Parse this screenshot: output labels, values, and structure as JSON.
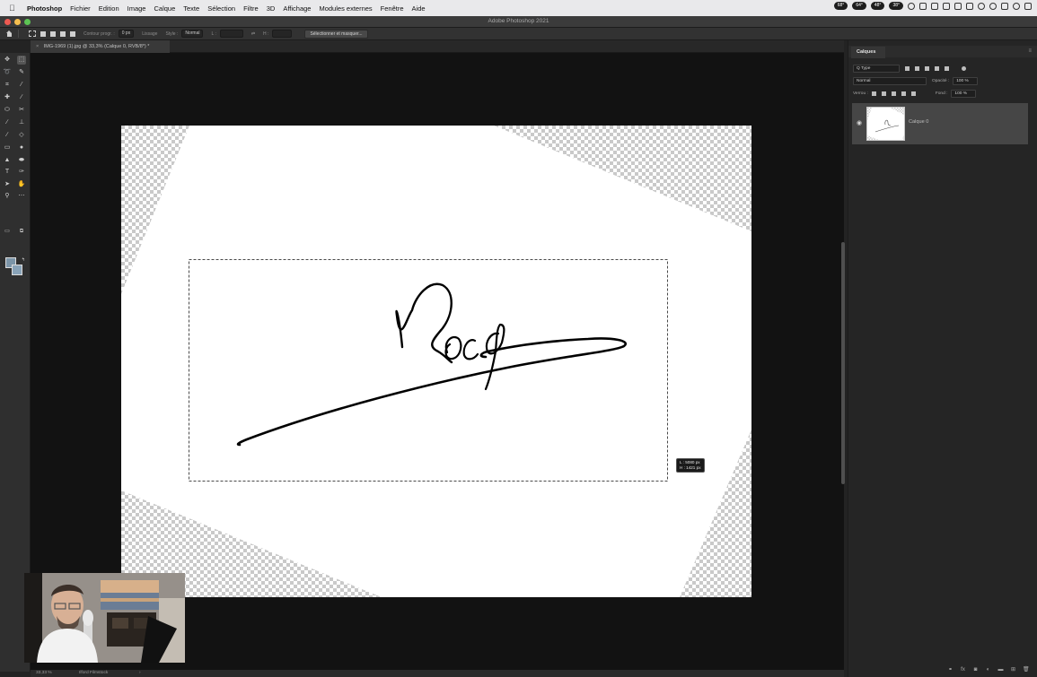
{
  "menubar": {
    "apple_icon": "apple-icon",
    "items": [
      "Photoshop",
      "Fichier",
      "Edition",
      "Image",
      "Calque",
      "Texte",
      "Sélection",
      "Filtre",
      "3D",
      "Affichage",
      "Modules externes",
      "Fenêtre",
      "Aide"
    ],
    "temps": [
      "68°",
      "64°",
      "48°",
      "38°"
    ]
  },
  "window": {
    "title": "Adobe Photoshop 2021"
  },
  "options": {
    "feather_label": "Contour progr. :",
    "feather_value": "0 px",
    "smoothing_label": "Lissage",
    "style_label": "Style :",
    "style_value": "Normal",
    "width_label": "L :",
    "height_label": "H :",
    "select_mask_button": "Sélectionner et masquer..."
  },
  "document": {
    "tab_close": "×",
    "tab_title": "IMG-1969 (1).jpg @ 33,3% (Calque 0, RVB/8*) *"
  },
  "canvas": {
    "size_width": "L : 5080 px",
    "size_height": "H : 1421 px"
  },
  "status": {
    "zoom": "33,33 %",
    "info": "Ilford Filmstock",
    "arrow": "›"
  },
  "layers_panel": {
    "title": "Calques",
    "menu_icon": "≡",
    "filter_type": "Q Type",
    "blend_mode": "Normal",
    "opacity_label": "Opacité :",
    "opacity_value": "100 %",
    "lock_label": "Verrou :",
    "fill_label": "Fond :",
    "fill_value": "100 %",
    "layer_name": "Calque 0",
    "footer_icons": [
      "fx",
      "mask",
      "adjust",
      "group",
      "new",
      "delete"
    ]
  },
  "colors": {
    "foreground": "#7c95a8",
    "background": "#89a3b8",
    "canvas_bg": "#121212",
    "panel_bg": "#252525"
  }
}
